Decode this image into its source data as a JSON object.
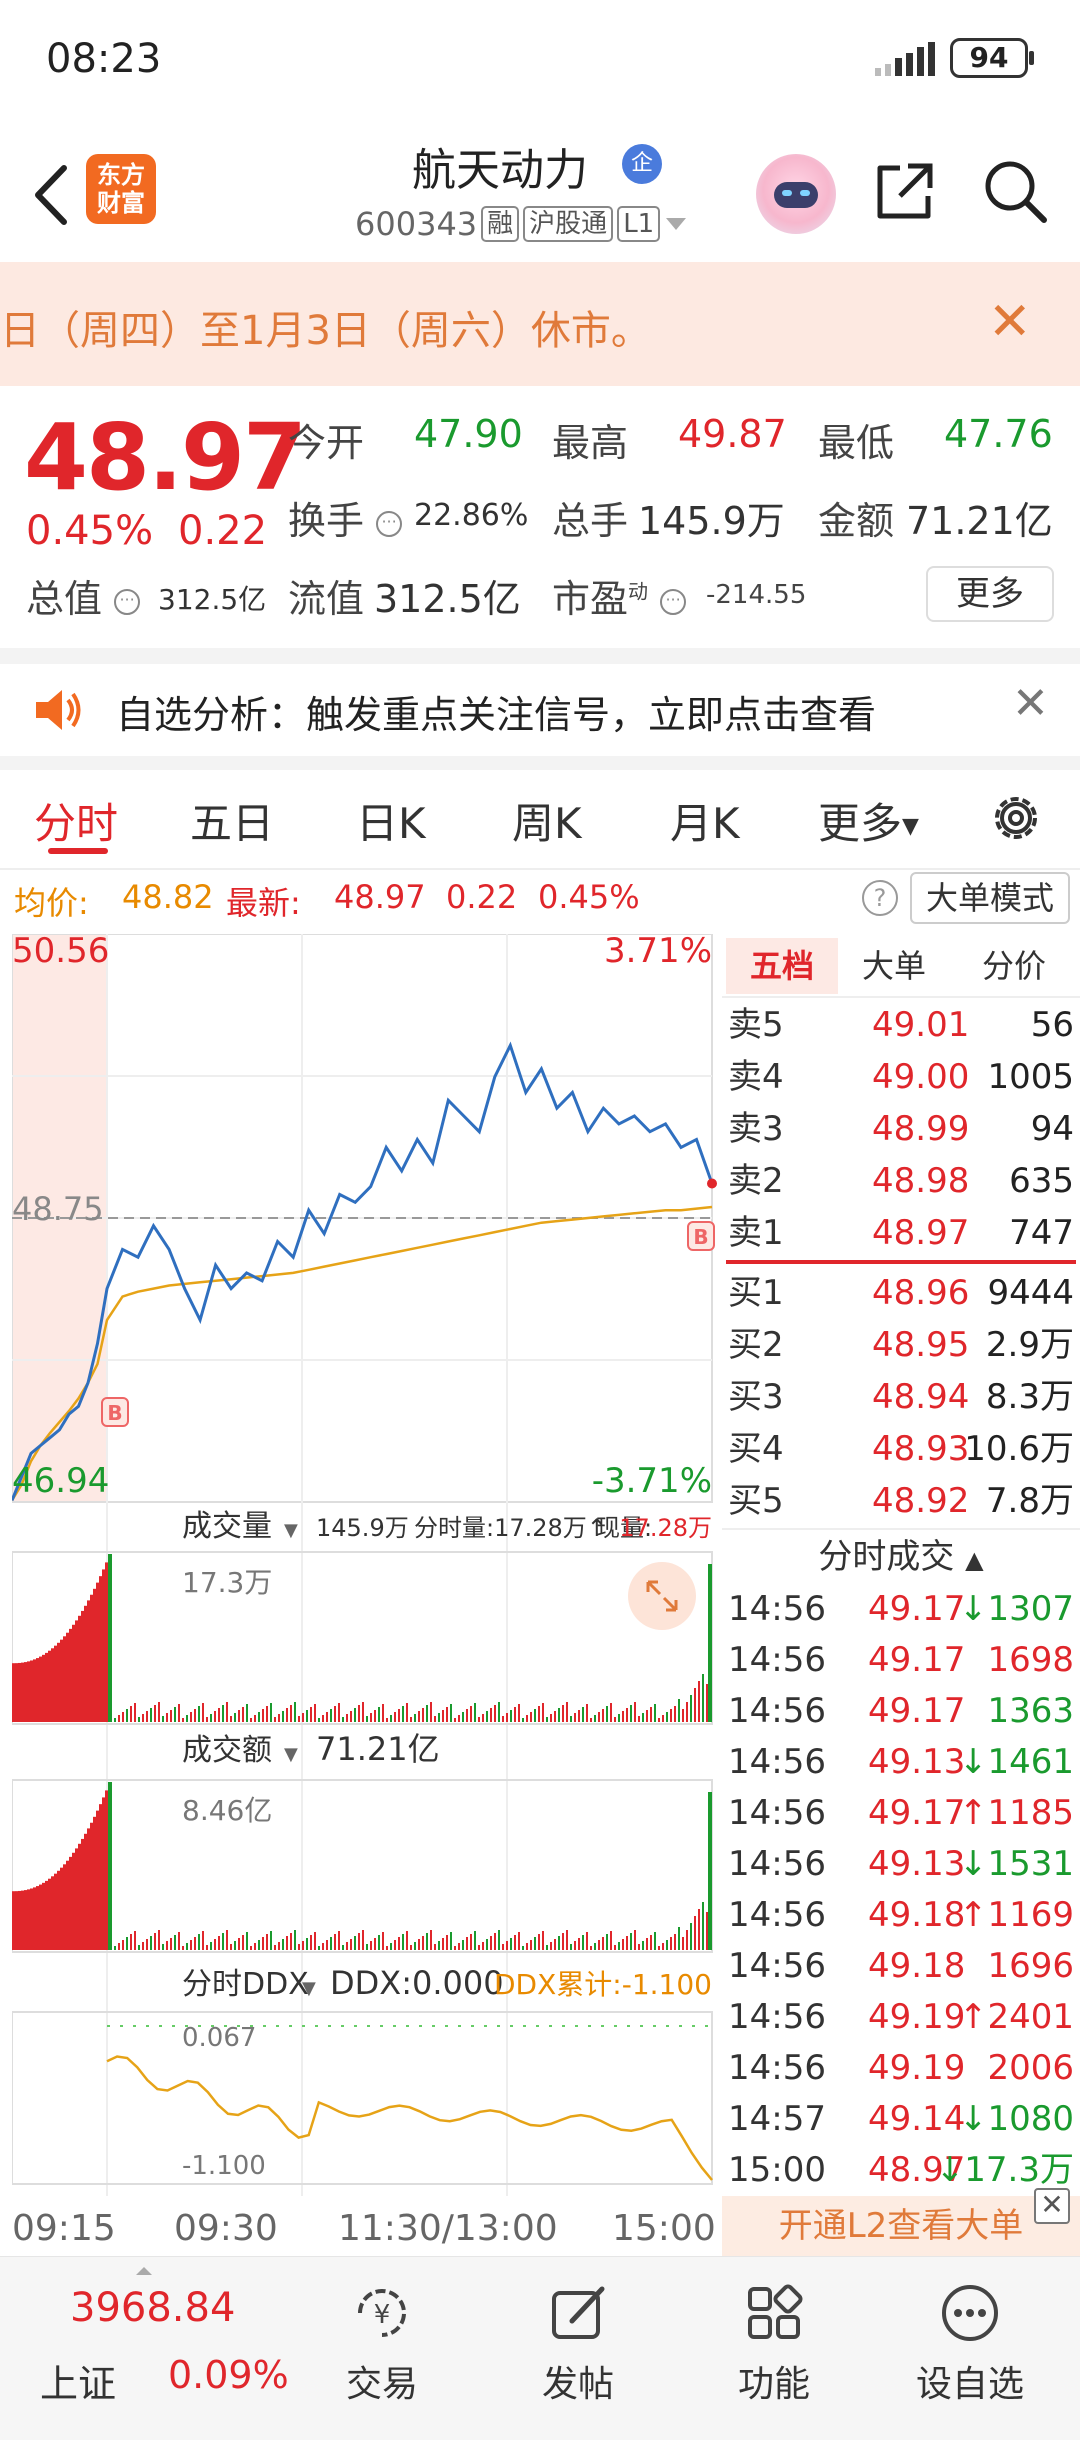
{
  "status_bar": {
    "time": "08:23",
    "battery": "94"
  },
  "header": {
    "logo_line1": "东方",
    "logo_line2": "财富",
    "stock_name": "航天动力",
    "enterprise_badge": "企",
    "stock_code": "600343",
    "tags": [
      "融",
      "沪股通",
      "L1"
    ]
  },
  "notice": {
    "text": "日（周四）至1月3日（周六）休市。"
  },
  "quote": {
    "price": "48.97",
    "pct": "0.45%",
    "change": "0.22",
    "open_label": "今开",
    "open": "47.90",
    "high_label": "最高",
    "high": "49.87",
    "low_label": "最低",
    "low": "47.76",
    "turnover_label": "换手",
    "turnover": "22.86%",
    "volume_label": "总手",
    "volume": "145.9万",
    "amount_label": "金额",
    "amount": "71.21亿",
    "mcap_label": "总值",
    "mcap": "312.5亿",
    "float_label": "流值",
    "float": "312.5亿",
    "pe_label": "市盈",
    "pe_sup": "动",
    "pe": "-214.55",
    "more": "更多"
  },
  "alert": {
    "text": "自选分析：触发重点关注信号，立即点击查看"
  },
  "tabs": [
    "分时",
    "五日",
    "日K",
    "周K",
    "月K",
    "更多"
  ],
  "info_line": {
    "avg_label": "均价:",
    "avg": "48.82",
    "latest_label": "最新:",
    "latest": "48.97",
    "change": "0.22",
    "pct": "0.45%",
    "big_order": "大单模式"
  },
  "chart_data": [
    {
      "type": "line",
      "title": "分时",
      "y_max_label": "50.56",
      "y_min_label": "46.94",
      "y_ref_label": "48.75",
      "pct_max_label": "3.71%",
      "pct_min_label": "-3.71%",
      "ylim": [
        46.94,
        50.56
      ],
      "reference": 48.75,
      "x_labels": [
        "09:15",
        "09:30",
        "11:30/13:00",
        "15:00"
      ],
      "series": [
        {
          "values": [
            46.95,
            47.1,
            47.25,
            47.3,
            47.35,
            47.4,
            47.5,
            47.55,
            47.7,
            47.95,
            48.3,
            48.55,
            48.5,
            48.7,
            48.55,
            48.3,
            48.1,
            48.45,
            48.3,
            48.4,
            48.35,
            48.6,
            48.5,
            48.8,
            48.65,
            48.9,
            48.85,
            48.95,
            49.2,
            49.05,
            49.25,
            49.1,
            49.5,
            49.4,
            49.3,
            49.65,
            49.85,
            49.55,
            49.7,
            49.45,
            49.55,
            49.3,
            49.45,
            49.35,
            49.4,
            49.3,
            49.35,
            49.2,
            49.25,
            48.97
          ]
        },
        {
          "values": [
            46.95,
            47.05,
            47.2,
            47.3,
            47.38,
            47.45,
            47.52,
            47.6,
            47.7,
            47.82,
            48.1,
            48.25,
            48.28,
            48.3,
            48.32,
            48.33,
            48.34,
            48.35,
            48.36,
            48.37,
            48.38,
            48.39,
            48.4,
            48.42,
            48.44,
            48.46,
            48.48,
            48.5,
            48.52,
            48.54,
            48.56,
            48.58,
            48.6,
            48.62,
            48.64,
            48.66,
            48.68,
            48.7,
            48.72,
            48.73,
            48.74,
            48.75,
            48.76,
            48.77,
            48.78,
            48.79,
            48.8,
            48.8,
            48.81,
            48.82
          ]
        }
      ]
    },
    {
      "type": "bar",
      "title": "成交量",
      "total": "145.9万",
      "minute_label": "分时量:17.28万↑",
      "current_label": "现量:",
      "current": "17.28万",
      "y_max_label": "17.3万"
    },
    {
      "type": "bar",
      "title": "成交额",
      "total": "71.21亿",
      "y_max_label": "8.46亿"
    },
    {
      "type": "line",
      "title": "分时DDX",
      "ddx_label": "DDX:0.000",
      "ddx_cum_label": "DDX累计:-1.100",
      "y_max_label": "0.067",
      "y_min_label": "-1.100"
    }
  ],
  "order_book": {
    "tabs": [
      "五档",
      "大单",
      "分价"
    ],
    "asks": [
      {
        "label": "卖5",
        "price": "49.01",
        "vol": "56"
      },
      {
        "label": "卖4",
        "price": "49.00",
        "vol": "1005"
      },
      {
        "label": "卖3",
        "price": "48.99",
        "vol": "94"
      },
      {
        "label": "卖2",
        "price": "48.98",
        "vol": "635"
      },
      {
        "label": "卖1",
        "price": "48.97",
        "vol": "747"
      }
    ],
    "bids": [
      {
        "label": "买1",
        "price": "48.96",
        "vol": "9444"
      },
      {
        "label": "买2",
        "price": "48.95",
        "vol": "2.9万"
      },
      {
        "label": "买3",
        "price": "48.94",
        "vol": "8.3万"
      },
      {
        "label": "买4",
        "price": "48.93",
        "vol": "10.6万"
      },
      {
        "label": "买5",
        "price": "48.92",
        "vol": "7.8万"
      }
    ],
    "trades_title": "分时成交",
    "trades": [
      {
        "time": "14:56",
        "price": "49.17",
        "vol": "↓1307",
        "dir": "down"
      },
      {
        "time": "14:56",
        "price": "49.17",
        "vol": "1698",
        "dir": "up"
      },
      {
        "time": "14:56",
        "price": "49.17",
        "vol": "1363",
        "dir": "down"
      },
      {
        "time": "14:56",
        "price": "49.13",
        "vol": "↓1461",
        "dir": "down"
      },
      {
        "time": "14:56",
        "price": "49.17",
        "vol": "↑1185",
        "dir": "up"
      },
      {
        "time": "14:56",
        "price": "49.13",
        "vol": "↓1531",
        "dir": "down"
      },
      {
        "time": "14:56",
        "price": "49.18",
        "vol": "↑1169",
        "dir": "up"
      },
      {
        "time": "14:56",
        "price": "49.18",
        "vol": "1696",
        "dir": "up"
      },
      {
        "time": "14:56",
        "price": "49.19",
        "vol": "↑2401",
        "dir": "up"
      },
      {
        "time": "14:56",
        "price": "49.19",
        "vol": "2006",
        "dir": "up"
      },
      {
        "time": "14:57",
        "price": "49.14",
        "vol": "↓1080",
        "dir": "down"
      },
      {
        "time": "15:00",
        "price": "48.97",
        "vol": "↓17.3万",
        "dir": "down"
      }
    ],
    "l2_text": "开通L2查看大单"
  },
  "bottom_nav": {
    "index_value": "3968.84",
    "index_name": "上证",
    "index_pct": "0.09%",
    "items": [
      "交易",
      "发帖",
      "功能",
      "设自选"
    ]
  },
  "colors": {
    "up": "#e0262b",
    "down": "#1a9a2e",
    "accent": "#f26a21"
  }
}
